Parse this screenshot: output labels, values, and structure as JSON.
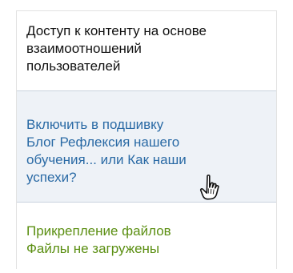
{
  "access_section": {
    "line1": "Доступ к контенту на основе",
    "line2": "взаимоотношений",
    "line3": "пользователей"
  },
  "binder_section": {
    "line1": "Включить в подшивку",
    "line2": "Блог Рефлексия нашего",
    "line3": "обучения... или Как наши",
    "line4": "успехи?"
  },
  "files_section": {
    "line1": "Прикрепление файлов",
    "line2": "Файлы не загружены"
  },
  "colors": {
    "link_blue": "#2a6aa5",
    "link_green": "#5b8f12",
    "binder_bg": "#eef2f7"
  },
  "cursor": {
    "icon": "hand-pointer-icon"
  }
}
